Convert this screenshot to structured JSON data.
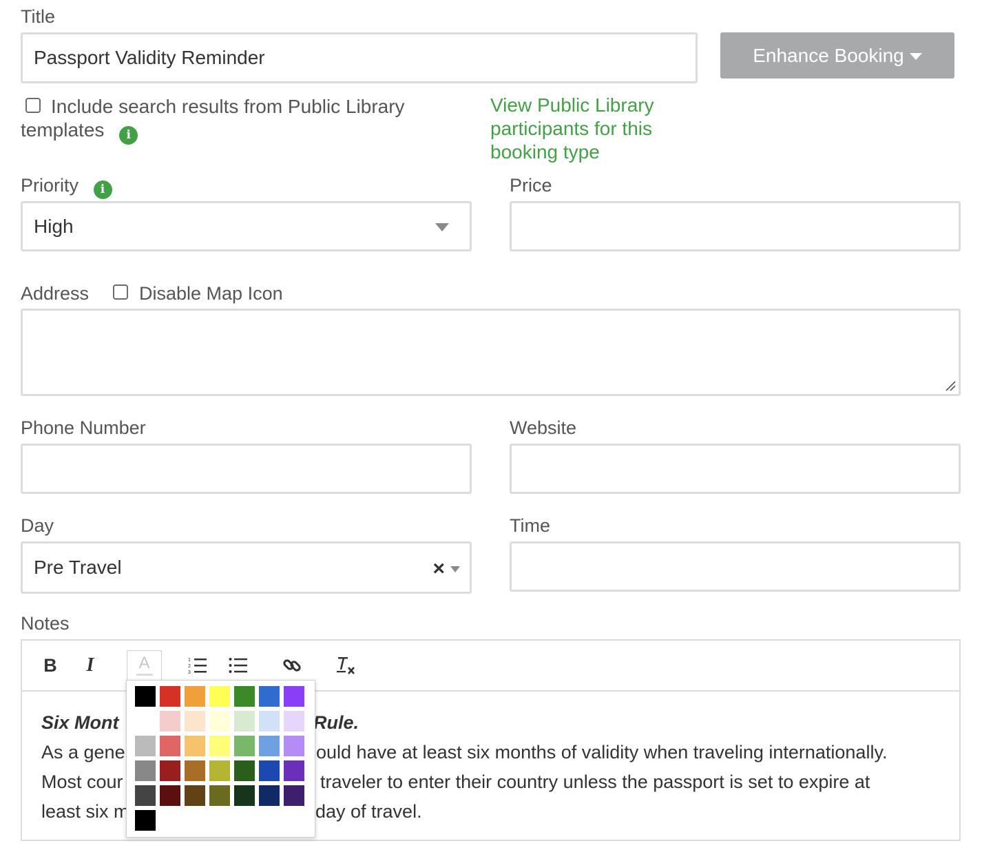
{
  "title_field": {
    "label": "Title",
    "value": "Passport Validity Reminder"
  },
  "enhance_button": {
    "label": "Enhance Booking"
  },
  "public_library": {
    "checkbox_label": "Include search results from Public Library templates",
    "checked": false,
    "link_text": "View Public Library participants for this booking type"
  },
  "priority": {
    "label": "Priority",
    "value": "High"
  },
  "price": {
    "label": "Price",
    "value": ""
  },
  "address": {
    "label": "Address",
    "disable_map_label": "Disable Map Icon",
    "disable_map_checked": false,
    "value": ""
  },
  "phone": {
    "label": "Phone Number",
    "value": ""
  },
  "website": {
    "label": "Website",
    "value": ""
  },
  "day": {
    "label": "Day",
    "value": "Pre Travel",
    "clear_glyph": "×"
  },
  "time": {
    "label": "Time",
    "value": ""
  },
  "notes": {
    "label": "Notes",
    "toolbar": {
      "bold": "B",
      "italic": "I",
      "text_color": "A",
      "ordered_list": "ordered-list-icon",
      "bullet_list": "bullet-list-icon",
      "link": "link-icon",
      "clear_format": "clear-format-icon"
    },
    "heading_visible_left": "Six Mont",
    "heading_visible_right": "Rule.",
    "line1_left": "As a gene",
    "line1_right": "ould have at least six months of validity when traveling internationally.",
    "line2_left": "Most cour",
    "line2_right": "traveler to enter their country unless the passport is set to expire at",
    "line3_left": "least six m",
    "line3_right": "day of travel."
  },
  "color_palette": {
    "rows": [
      [
        "#000000",
        "#d73125",
        "#f0a03a",
        "#ffff55",
        "#3a8a27",
        "#2f6ccb",
        "#8a3ef5"
      ],
      [
        "#ffffff",
        "#f4cccc",
        "#fce5cd",
        "#ffffd9",
        "#d9ead3",
        "#d2e1f6",
        "#e6d6fb"
      ],
      [
        "#bbbbbb",
        "#e06666",
        "#f6c26b",
        "#ffff77",
        "#79b76b",
        "#6fa0e0",
        "#b58bf5"
      ],
      [
        "#888888",
        "#991f1f",
        "#a86d26",
        "#b5b534",
        "#2a5e1c",
        "#1d48b0",
        "#6a30b7"
      ],
      [
        "#444444",
        "#5c0f0f",
        "#634117",
        "#6b6b1f",
        "#17351a",
        "#102a66",
        "#3d1f6e"
      ],
      [
        "#000000"
      ]
    ]
  },
  "colors": {
    "accent_green": "#43a047",
    "button_gray": "#a8a9aa",
    "border_gray": "#dcdcdc"
  }
}
